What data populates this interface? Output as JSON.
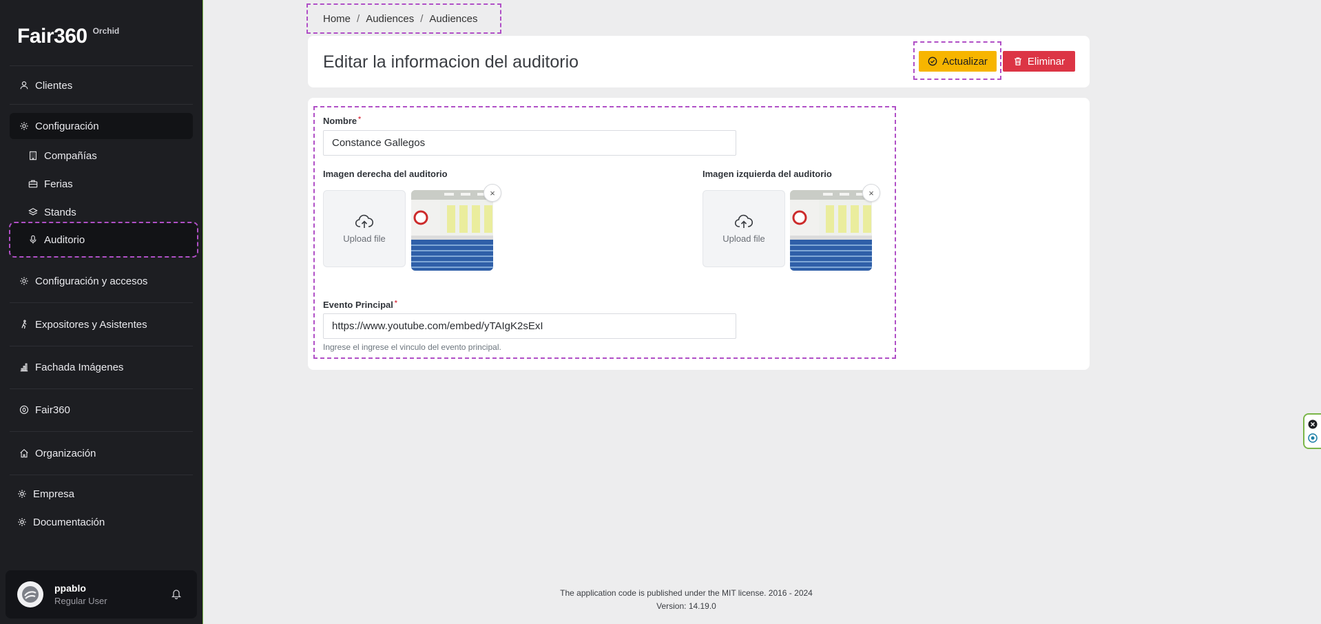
{
  "app": {
    "brand": "Fair360",
    "brand_sub": "Orchid"
  },
  "sidebar": {
    "items": [
      {
        "label": "Clientes",
        "icon": "person-icon"
      },
      {
        "label": "Configuración",
        "icon": "gear-icon"
      },
      {
        "label": "Compañías",
        "icon": "building-icon"
      },
      {
        "label": "Ferias",
        "icon": "briefcase-icon"
      },
      {
        "label": "Stands",
        "icon": "layers-icon"
      },
      {
        "label": "Auditorio",
        "icon": "microphone-icon"
      },
      {
        "label": "Configuración y accesos",
        "icon": "gear-icon"
      },
      {
        "label": "Expositores y Asistentes",
        "icon": "walking-icon"
      },
      {
        "label": "Fachada Imágenes",
        "icon": "bar-chart-icon"
      },
      {
        "label": "Fair360",
        "icon": "circle-zero-icon"
      },
      {
        "label": "Organización",
        "icon": "home-icon"
      },
      {
        "label": "Empresa",
        "icon": "gear-icon"
      },
      {
        "label": "Documentación",
        "icon": "gear-icon"
      }
    ],
    "user": {
      "name": "ppablo",
      "role": "Regular User"
    }
  },
  "breadcrumb": [
    "Home",
    "Audiences",
    "Audiences"
  ],
  "page": {
    "title": "Editar la informacion del auditorio",
    "update_label": "Actualizar",
    "delete_label": "Eliminar"
  },
  "form": {
    "nombre_label": "Nombre",
    "nombre_required": "*",
    "nombre_value": "Constance Gallegos",
    "img_right_label": "Imagen derecha del auditorio",
    "img_left_label": "Imagen izquierda del auditorio",
    "upload_label": "Upload file",
    "close_glyph": "×",
    "evento_label": "Evento Principal",
    "evento_required": "*",
    "evento_value": "https://www.youtube.com/embed/yTAIgK2sExI",
    "evento_help": "Ingrese el ingrese el vinculo del evento principal."
  },
  "footer": {
    "license": "The application code is published under the MIT license. 2016 - 2024",
    "version": "Version: 14.19.0"
  },
  "colors": {
    "sidebar_bg": "#1d1e22",
    "update_btn": "#f7b500",
    "delete_btn": "#dc3545",
    "highlight": "#b04fc6"
  }
}
